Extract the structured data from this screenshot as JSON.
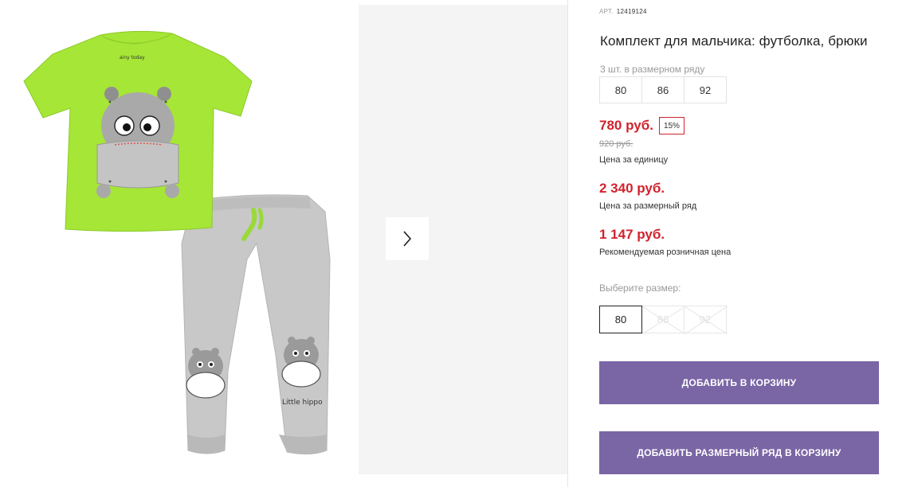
{
  "product": {
    "article_label": "АРТ.",
    "article_number": "12419124",
    "title": "Комплект для мальчика: футболка, брюки",
    "row_info": "3 шт. в размерном ряду",
    "row_sizes": [
      "80",
      "86",
      "92"
    ],
    "shirt_brand": "ainy today",
    "pants_print": "Little hippo"
  },
  "prices": {
    "unit_price": "780 руб.",
    "discount": "15%",
    "old_price": "920 руб.",
    "unit_label": "Цена за единицу",
    "row_price": "2 340 руб.",
    "row_label": "Цена за размерный ряд",
    "retail_price": "1 147 руб.",
    "retail_label": "Рекомендуемая розничная цена"
  },
  "size_picker": {
    "label": "Выберите размер:",
    "options": [
      {
        "label": "80",
        "state": "selected"
      },
      {
        "label": "86",
        "state": "disabled"
      },
      {
        "label": "92",
        "state": "disabled"
      }
    ]
  },
  "actions": {
    "add_to_cart": "ДОБАВИТЬ В КОРЗИНУ",
    "add_row_to_cart": "ДОБАВИТЬ РАЗМЕРНЫЙ РЯД В КОРЗИНУ"
  },
  "gallery": {
    "next_icon": "chevron-right-icon"
  },
  "colors": {
    "accent_price": "#d2222d",
    "button": "#7a65a5",
    "shirt": "#a6e636",
    "pants": "#c9c9c9"
  }
}
